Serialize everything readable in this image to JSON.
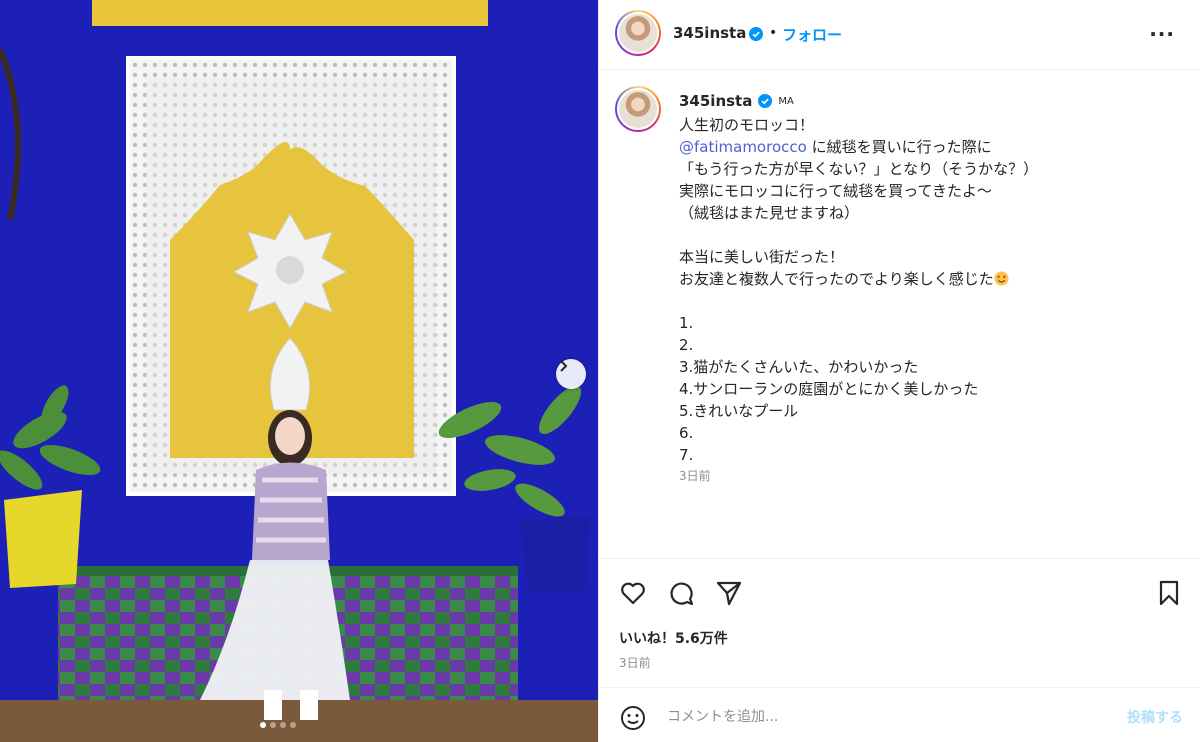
{
  "post": {
    "username": "345insta",
    "follow_label": "フォロー",
    "separator": "•",
    "more_icon": "more-horizontal-icon"
  },
  "caption": {
    "username": "345insta",
    "tag": "MA",
    "line1": "人生初のモロッコ！",
    "mention": "@fatimamorocco",
    "line2_rest": " に絨毯を買いに行った際に",
    "line3": "「もう行った方が早くない？」となり（そうかな？）",
    "line4": "実際にモロッコに行って絨毯を買ってきたよ〜",
    "line5": "（絨毯はまた見せますね）",
    "line6": "本当に美しい街だった！",
    "line7": "お友達と複数人で行ったのでより楽しく感じた",
    "list": [
      "1.",
      "2.",
      "3.猫がたくさんいた、かわいかった",
      "4.サンローランの庭園がとにかく美しかった",
      "5.きれいなプール",
      "6.",
      "7."
    ],
    "time_ago": "3日前"
  },
  "actions": {
    "likes": "いいね！5.6万件",
    "time_ago": "3日前"
  },
  "comment": {
    "placeholder": "コメントを追加...",
    "post_label": "投稿する"
  },
  "colors": {
    "link": "#0095f6",
    "mention": "#4c5fd7",
    "muted": "#8e8e8e",
    "wall_blue": "#1a1fb0",
    "wall_yellow": "#e3c33d"
  },
  "carousel": {
    "slides": 4,
    "active": 1
  }
}
